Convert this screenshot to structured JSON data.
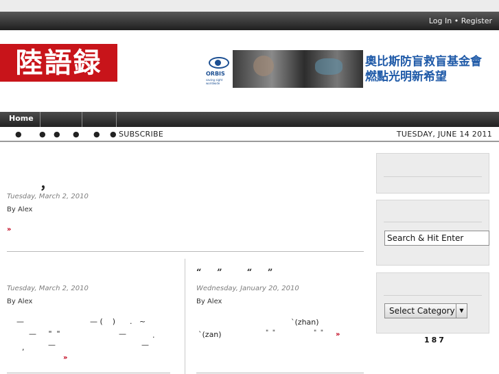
{
  "header": {
    "login": "Log In",
    "bullet": "•",
    "register": "Register",
    "logo_text": "陸語録"
  },
  "ad": {
    "brand": "ORBIS",
    "tagline": "saving sight worldwide",
    "line1": "奧比斯防盲救盲基金會",
    "line2": "燃點光明新希望"
  },
  "nav": {
    "home": "Home"
  },
  "subnav": {
    "dot": "●",
    "subscribe": "SUBSCRIBE",
    "date": "TUESDAY, JUNE 14 2011"
  },
  "posts": [
    {
      "title": "，",
      "date": "Tuesday, March 2, 2010",
      "by": "By Alex",
      "more": "»"
    },
    {
      "date": "Tuesday, March 2, 2010",
      "by": "By Alex",
      "l1a": "—",
      "l1b": "— (    )      .   ~",
      "l2a": "—     \"  \"",
      "l2b": "—",
      "l2c": ".",
      "l3a": ",",
      "l3b": "—",
      "l3c": "—",
      "more": "»"
    },
    {
      "title": "“     ”        “     ”",
      "date": "Wednesday, January 20, 2010",
      "by": "By Alex",
      "l1": "`(zhan)",
      "l2a": "`(zan)",
      "l2b": "\"  \"",
      "l2c": "\"  \"",
      "more": "»"
    }
  ],
  "sidebar": {
    "search_placeholder": "Search & Hit Enter",
    "category_label": "Select Category",
    "counter": "187"
  }
}
